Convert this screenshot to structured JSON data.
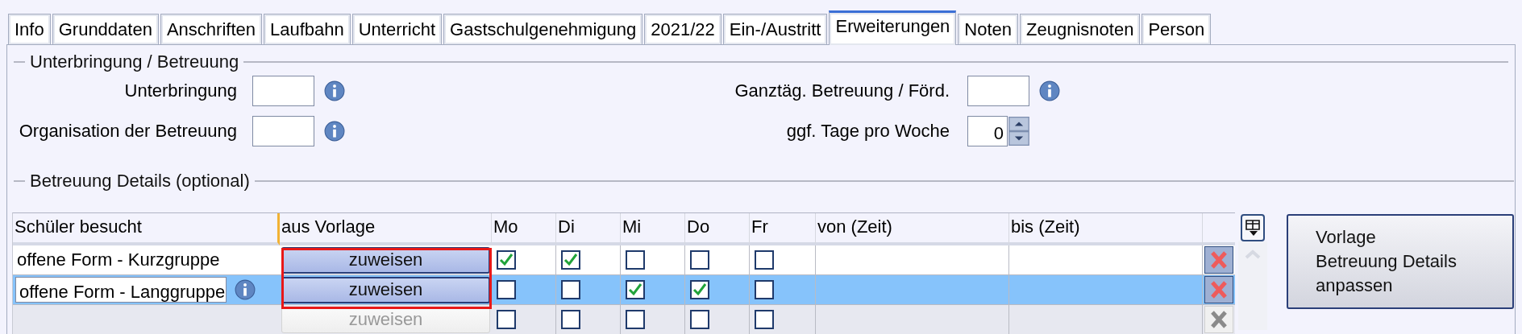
{
  "tabs": [
    {
      "label": "Info",
      "selected": false
    },
    {
      "label": "Grunddaten",
      "selected": false
    },
    {
      "label": "Anschriften",
      "selected": false
    },
    {
      "label": "Laufbahn",
      "selected": false
    },
    {
      "label": "Unterricht",
      "selected": false
    },
    {
      "label": "Gastschulgenehmigung",
      "selected": false
    },
    {
      "label": "2021/22",
      "selected": false
    },
    {
      "label": "Ein-/Austritt",
      "selected": false
    },
    {
      "label": "Erweiterungen",
      "selected": true
    },
    {
      "label": "Noten",
      "selected": false
    },
    {
      "label": "Zeugnisnoten",
      "selected": false
    },
    {
      "label": "Person",
      "selected": false
    }
  ],
  "unterbringung": {
    "legend": "Unterbringung / Betreuung",
    "left_fields": [
      {
        "label": "Unterbringung",
        "kind": "code"
      },
      {
        "label": "Organisation der Betreuung",
        "kind": "code"
      }
    ],
    "right_fields": [
      {
        "label": "Ganztäg. Betreuung / Förd.",
        "kind": "code"
      },
      {
        "label": "ggf. Tage pro Woche",
        "kind": "spin",
        "value": "0"
      }
    ]
  },
  "details": {
    "legend": "Betreuung Details (optional)",
    "columns": [
      "Schüler besucht",
      "aus Vorlage",
      "Mo",
      "Di",
      "Mi",
      "Do",
      "Fr",
      "von (Zeit)",
      "bis (Zeit)"
    ],
    "assign_highlight": true,
    "rows": [
      {
        "kind": "plain",
        "selected": false,
        "name": "offene Form - Kurzgruppe",
        "assign": "zuweisen",
        "days": [
          true,
          true,
          false,
          false,
          false
        ]
      },
      {
        "kind": "editing",
        "selected": true,
        "name": "offene Form - Langgruppe",
        "assign": "zuweisen",
        "days": [
          false,
          false,
          true,
          true,
          false
        ]
      },
      {
        "kind": "new",
        "selected": false,
        "assign": "zuweisen",
        "days": [
          false,
          false,
          false,
          false,
          false
        ]
      }
    ],
    "template_button": [
      "Vorlage",
      "Betreuung Details",
      "anpassen"
    ]
  }
}
